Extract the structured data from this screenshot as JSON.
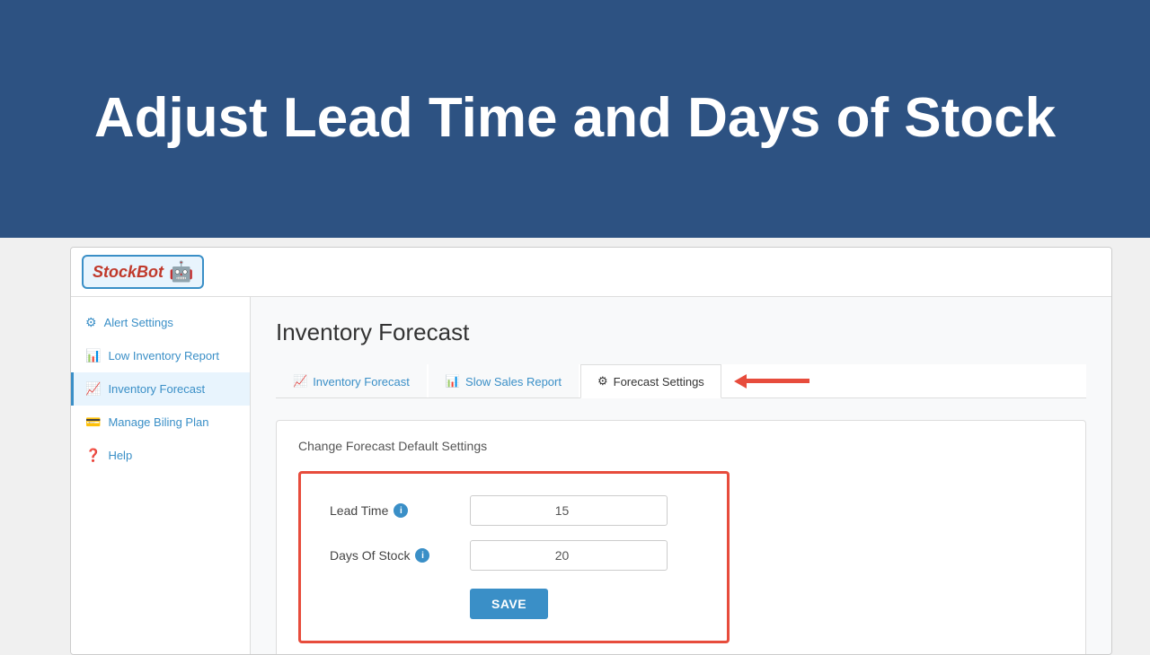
{
  "hero": {
    "title": "Adjust Lead Time and Days of Stock"
  },
  "app": {
    "logo_text": "StockBot",
    "logo_emoji": "🤖"
  },
  "sidebar": {
    "items": [
      {
        "id": "alert-settings",
        "icon": "⚙",
        "label": "Alert Settings",
        "active": false
      },
      {
        "id": "low-inventory-report",
        "icon": "📊",
        "label": "Low Inventory Report",
        "active": false
      },
      {
        "id": "inventory-forecast",
        "icon": "📈",
        "label": "Inventory Forecast",
        "active": true
      },
      {
        "id": "manage-billing-plan",
        "icon": "💳",
        "label": "Manage Biling Plan",
        "active": false
      },
      {
        "id": "help",
        "icon": "❓",
        "label": "Help",
        "active": false
      }
    ]
  },
  "main": {
    "page_title": "Inventory Forecast",
    "tabs": [
      {
        "id": "inventory-forecast-tab",
        "icon": "📈",
        "label": "Inventory Forecast",
        "active": false
      },
      {
        "id": "slow-sales-report-tab",
        "icon": "📊",
        "label": "Slow Sales Report",
        "active": false
      },
      {
        "id": "forecast-settings-tab",
        "icon": "⚙",
        "label": "Forecast Settings",
        "active": true
      }
    ],
    "settings_card": {
      "title": "Change Forecast Default Settings",
      "lead_time_label": "Lead Time",
      "lead_time_value": "15",
      "days_of_stock_label": "Days Of Stock",
      "days_of_stock_value": "20",
      "save_label": "SAVE"
    }
  }
}
